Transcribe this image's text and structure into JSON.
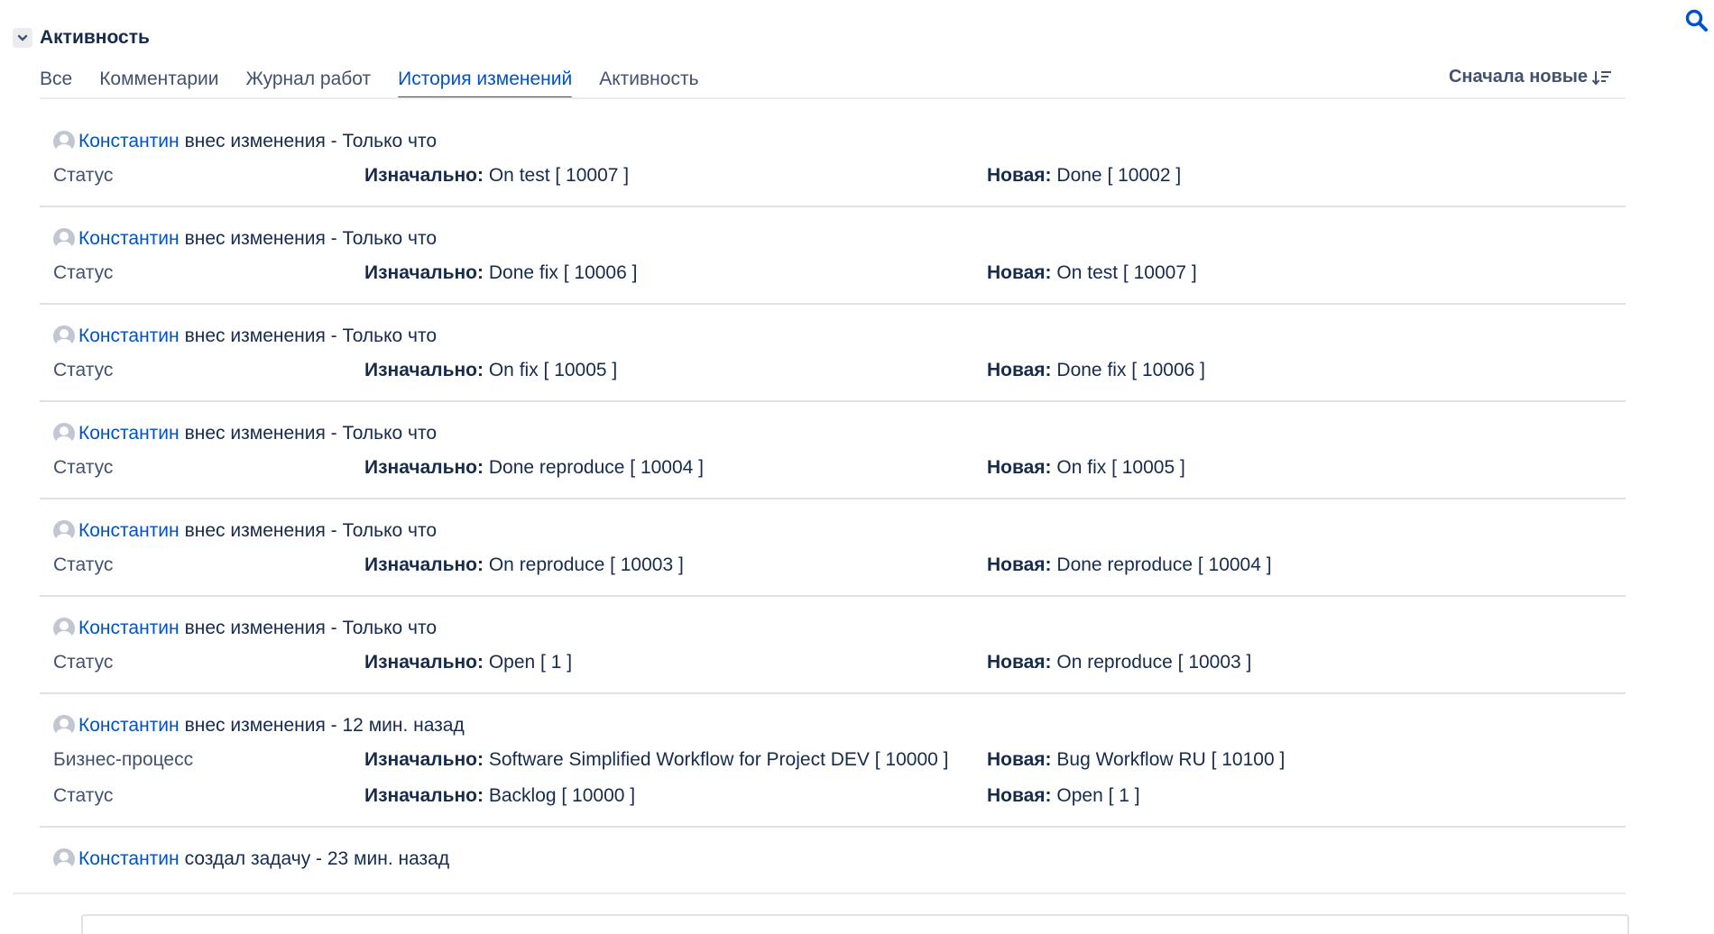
{
  "section": {
    "title": "Активность"
  },
  "tabs": [
    {
      "label": "Все",
      "active": false
    },
    {
      "label": "Комментарии",
      "active": false
    },
    {
      "label": "Журнал работ",
      "active": false
    },
    {
      "label": "История изменений",
      "active": true
    },
    {
      "label": "Активность",
      "active": false
    }
  ],
  "sort": {
    "label": "Сначала новые"
  },
  "labels": {
    "original": "Изначально:",
    "new": "Новая:"
  },
  "entries": [
    {
      "user": "Константин",
      "action": "внес изменения - Только что",
      "changes": [
        {
          "field": "Статус",
          "old": "On test [ 10007 ]",
          "new": "Done [ 10002 ]"
        }
      ]
    },
    {
      "user": "Константин",
      "action": "внес изменения - Только что",
      "changes": [
        {
          "field": "Статус",
          "old": "Done fix [ 10006 ]",
          "new": "On test [ 10007 ]"
        }
      ]
    },
    {
      "user": "Константин",
      "action": "внес изменения - Только что",
      "changes": [
        {
          "field": "Статус",
          "old": "On fix [ 10005 ]",
          "new": "Done fix [ 10006 ]"
        }
      ]
    },
    {
      "user": "Константин",
      "action": "внес изменения - Только что",
      "changes": [
        {
          "field": "Статус",
          "old": "Done reproduce [ 10004 ]",
          "new": "On fix [ 10005 ]"
        }
      ]
    },
    {
      "user": "Константин",
      "action": "внес изменения - Только что",
      "changes": [
        {
          "field": "Статус",
          "old": "On reproduce [ 10003 ]",
          "new": "Done reproduce [ 10004 ]"
        }
      ]
    },
    {
      "user": "Константин",
      "action": "внес изменения - Только что",
      "changes": [
        {
          "field": "Статус",
          "old": "Open [ 1 ]",
          "new": "On reproduce [ 10003 ]"
        }
      ]
    },
    {
      "user": "Константин",
      "action": "внес изменения - 12 мин. назад",
      "changes": [
        {
          "field": "Бизнес-процесс",
          "old": "Software Simplified Workflow for Project DEV [ 10000 ]",
          "new": "Bug Workflow RU [ 10100 ]"
        },
        {
          "field": "Статус",
          "old": "Backlog [ 10000 ]",
          "new": "Open [ 1 ]"
        }
      ]
    },
    {
      "user": "Константин",
      "action": "создал задачу - 23 мин. назад",
      "changes": []
    }
  ],
  "colors": {
    "link": "#0052cc",
    "text": "#172b4d",
    "muted": "#42526e",
    "divider": "#dfe1e6"
  }
}
